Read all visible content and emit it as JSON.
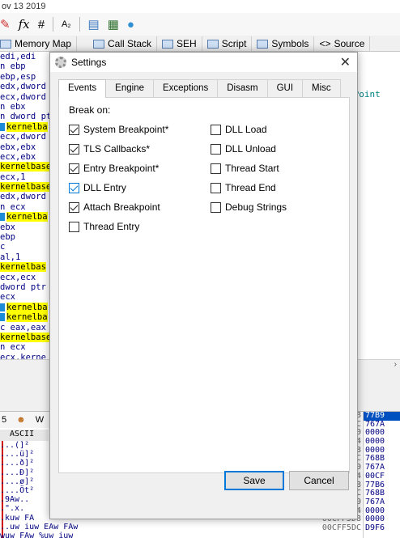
{
  "window": {
    "title_fragment": "ov 13 2019"
  },
  "toolbar": {
    "icons": [
      "brush-icon",
      "fx-icon",
      "hash-icon",
      "font-icon",
      "db-icon",
      "calculator-icon",
      "globe-icon"
    ],
    "fx_label": "fx",
    "hash_label": "#",
    "font_label": "A₂"
  },
  "bg_tabs": [
    {
      "label": "Memory Map"
    },
    {
      "label": "Call Stack"
    },
    {
      "label": "SEH"
    },
    {
      "label": "Script"
    },
    {
      "label": "Symbols"
    },
    {
      "label": "Source"
    }
  ],
  "code_lines": [
    {
      "pre": "edi,edi",
      "hl": ""
    },
    {
      "pre": "n ebp",
      "hl": ""
    },
    {
      "pre": "ebp,esp",
      "hl": ""
    },
    {
      "pre": "edx,dword",
      "hl": ""
    },
    {
      "pre": "ecx,dword",
      "hl": ""
    },
    {
      "pre": "n ebx",
      "hl": ""
    },
    {
      "pre": "n dword pt",
      "hl": ""
    },
    {
      "pre": "",
      "hl": "kernelba",
      "mark": true
    },
    {
      "pre": "ecx,dword",
      "hl": ""
    },
    {
      "pre": "ebx,ebx",
      "hl": ""
    },
    {
      "pre": "ecx,ebx",
      "hl": ""
    },
    {
      "pre": "",
      "hl": "kernelbase"
    },
    {
      "pre": "ecx,1",
      "hl": ""
    },
    {
      "pre": "",
      "hl": "kernelbase"
    },
    {
      "pre": "edx,dword",
      "hl": ""
    },
    {
      "pre": "n ecx",
      "hl": ""
    },
    {
      "pre": "",
      "hl": "kernelba",
      "mark": true
    },
    {
      "pre": "ebx",
      "hl": ""
    },
    {
      "pre": "ebp",
      "hl": ""
    },
    {
      "pre": "c",
      "hl": ""
    },
    {
      "pre": "al,1",
      "hl": ""
    },
    {
      "pre": "",
      "hl": "kernelbas"
    },
    {
      "pre": "ecx,ecx",
      "hl": ""
    },
    {
      "pre": "dword ptr",
      "hl": ""
    },
    {
      "pre": "ecx",
      "hl": ""
    },
    {
      "pre": "",
      "hl": "kernelba",
      "mark": true
    },
    {
      "pre": "",
      "hl": "kernelba",
      "mark": true
    },
    {
      "pre": "c eax,eax",
      "hl": ""
    },
    {
      "pre": "",
      "hl": "kernelbase"
    },
    {
      "pre": "n ecx",
      "hl": ""
    },
    {
      "pre": "ecx,kerne",
      "hl": ""
    },
    {
      "pre": "",
      "hl": "kernelba",
      "mark": true
    }
  ],
  "right_fragment": "yPoint",
  "bottom": {
    "tabs": [
      "5",
      "W"
    ],
    "ascii_header": "ASCII",
    "ascii_rows": [
      "...(]²",
      "....ü]²",
      "....ð]²",
      "....Ð]²",
      "....ø]²",
      "....Öt²",
      ".9Aw..",
      ".\".x.",
      ".kuw FA",
      "..uw iuw EAw FAw",
      "wuw FAw %uw iuw"
    ],
    "stack_addrs": [
      "8",
      "C",
      "0",
      "4",
      "8",
      "C",
      "0",
      "4",
      "8",
      "C",
      "0",
      "4",
      "00CFF5D8",
      "00CFF5DC"
    ],
    "stack_vals": [
      "77B9",
      "767A",
      "0000",
      "0000",
      "0000",
      "768B",
      "767A",
      "00CF",
      "77B6",
      "768B",
      "767A",
      "0000",
      "0000",
      "D9F6"
    ]
  },
  "dialog": {
    "title": "Settings",
    "close_glyph": "✕",
    "tabs": [
      "Events",
      "Engine",
      "Exceptions",
      "Disasm",
      "GUI",
      "Misc"
    ],
    "active_tab": "Events",
    "break_on_label": "Break on:",
    "left_options": [
      {
        "label": "System Breakpoint*",
        "checked": true
      },
      {
        "label": "TLS Callbacks*",
        "checked": true
      },
      {
        "label": "Entry Breakpoint*",
        "checked": true
      },
      {
        "label": "DLL Entry",
        "checked": true,
        "focused": true
      },
      {
        "label": "Attach Breakpoint",
        "checked": true
      },
      {
        "label": "Thread Entry",
        "checked": false
      }
    ],
    "right_options": [
      {
        "label": "DLL Load",
        "checked": false
      },
      {
        "label": "DLL Unload",
        "checked": false
      },
      {
        "label": "Thread Start",
        "checked": false
      },
      {
        "label": "Thread End",
        "checked": false
      },
      {
        "label": "Debug Strings",
        "checked": false
      }
    ],
    "save_label": "Save",
    "cancel_label": "Cancel"
  },
  "colors": {
    "highlight": "#ffff00",
    "accent": "#0078d7",
    "code_text": "#000080"
  }
}
